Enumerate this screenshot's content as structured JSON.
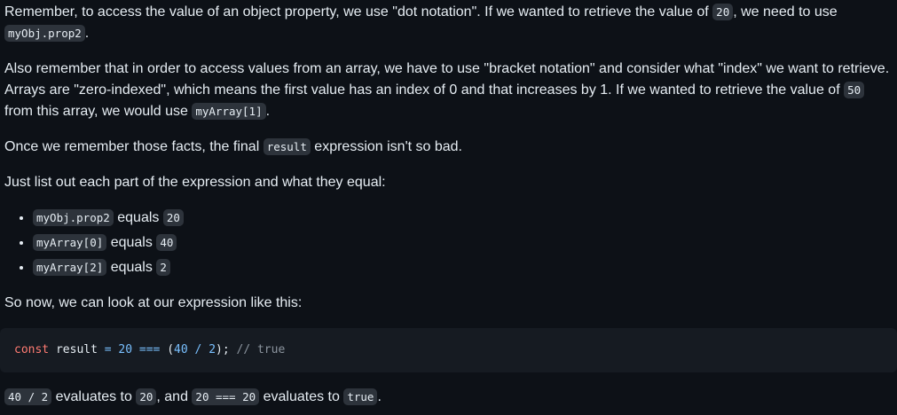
{
  "p1": {
    "t1": "Remember, to access the value of an object property, we use \"dot notation\". If we wanted to retrieve the value of ",
    "c1": "20",
    "t2": ", we need to use ",
    "c2": "myObj.prop2",
    "t3": "."
  },
  "p2": {
    "t1": "Also remember that in order to access values from an array, we have to use \"bracket notation\" and consider what \"index\" we want to retrieve. Arrays are \"zero-indexed\", which means the first value has an index of 0 and that increases by 1. If we wanted to retrieve the value of ",
    "c1": "50",
    "t2": " from this array, we would use ",
    "c2": "myArray[1]",
    "t3": "."
  },
  "p3": {
    "t1": "Once we remember those facts, the final ",
    "c1": "result",
    "t2": " expression isn't so bad."
  },
  "p4": "Just list out each part of the expression and what they equal:",
  "list": [
    {
      "code": "myObj.prop2",
      "word": " equals ",
      "value": "20"
    },
    {
      "code": "myArray[0]",
      "word": " equals ",
      "value": "40"
    },
    {
      "code": "myArray[2]",
      "word": " equals ",
      "value": "2"
    }
  ],
  "p5": "So now, we can look at our expression like this:",
  "code_block": {
    "kw": "const",
    "var": " result ",
    "eq": "=",
    "n20": " 20 ",
    "triple": "===",
    "open": " (",
    "n40": "40",
    "div": " / ",
    "n2": "2",
    "close": ");",
    "comment": " // true"
  },
  "p6": {
    "c1": "40 / 2",
    "t1": " evaluates to ",
    "c2": "20",
    "t2": ", and ",
    "c3": "20 === 20",
    "t3": " evaluates to ",
    "c4": "true",
    "t4": "."
  }
}
